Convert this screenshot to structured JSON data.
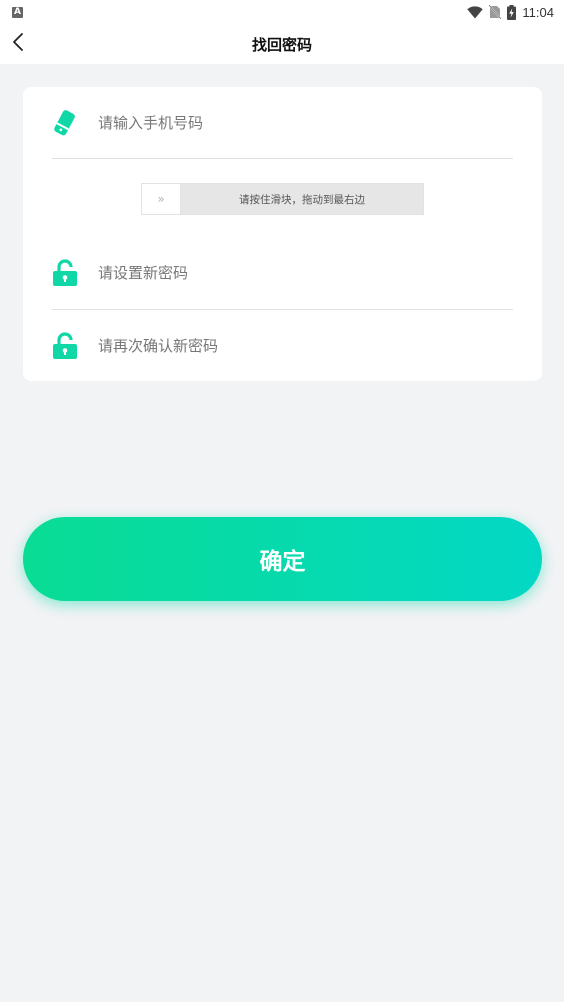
{
  "status_bar": {
    "app_icon_letter": "A",
    "time": "11:04",
    "icons": [
      "wifi-icon",
      "no-sim-icon",
      "battery-charging-icon"
    ]
  },
  "header": {
    "title": "找回密码",
    "back_icon": "chevron-left-icon"
  },
  "form": {
    "phone": {
      "placeholder": "请输入手机号码",
      "value": "",
      "icon": "phone-icon"
    },
    "slider": {
      "text": "请按住滑块，拖动到最右边",
      "handle_glyph": "»"
    },
    "new_password": {
      "placeholder": "请设置新密码",
      "value": "",
      "icon": "lock-icon"
    },
    "confirm_password": {
      "placeholder": "请再次确认新密码",
      "value": "",
      "icon": "lock-icon"
    }
  },
  "actions": {
    "confirm_label": "确定"
  },
  "colors": {
    "accent_start": "#09dc93",
    "accent_end": "#03d8c5",
    "icon": "#10d7a6",
    "background": "#f2f3f5"
  }
}
